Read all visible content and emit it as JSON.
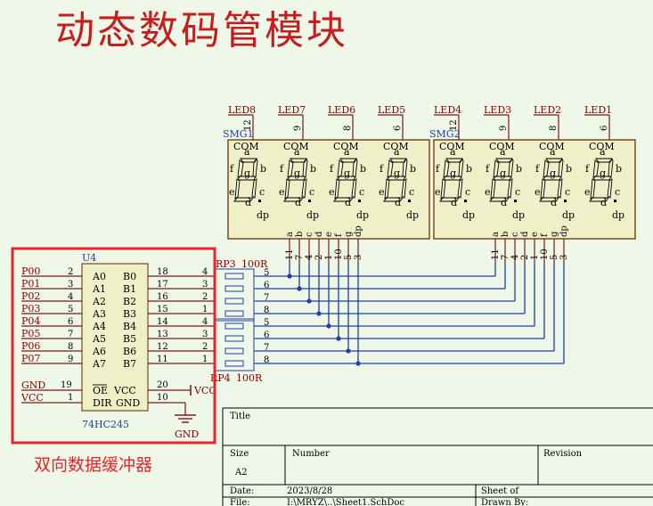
{
  "title": "动态数码管模块",
  "caption": "双向数据缓冲器",
  "smg1": {
    "ref": "SMG1",
    "digits": [
      {
        "led": "LED8",
        "pin": "12"
      },
      {
        "led": "LED7",
        "pin": "9"
      },
      {
        "led": "LED6",
        "pin": "8"
      },
      {
        "led": "LED5",
        "pin": "6"
      }
    ]
  },
  "smg2": {
    "ref": "SMG2",
    "digits": [
      {
        "led": "LED4",
        "pin": "12"
      },
      {
        "led": "LED3",
        "pin": "9"
      },
      {
        "led": "LED2",
        "pin": "8"
      },
      {
        "led": "LED1",
        "pin": "6"
      }
    ]
  },
  "digit_labels": {
    "com": "COM",
    "a": "a",
    "b": "b",
    "c": "c",
    "d": "d",
    "e": "e",
    "f": "f",
    "g": "g",
    "dp": "dp"
  },
  "seg_pins": {
    "names": [
      "a",
      "b",
      "c",
      "d",
      "e",
      "f",
      "g",
      "dp"
    ],
    "numbers": [
      "11",
      "7",
      "4",
      "2",
      "1",
      "10",
      "5",
      "3"
    ]
  },
  "u4": {
    "ref": "U4",
    "part": "74HC245",
    "left": [
      {
        "net": "P00",
        "pin": "2",
        "name": "A0"
      },
      {
        "net": "P01",
        "pin": "3",
        "name": "A1"
      },
      {
        "net": "P02",
        "pin": "4",
        "name": "A2"
      },
      {
        "net": "P03",
        "pin": "5",
        "name": "A3"
      },
      {
        "net": "P04",
        "pin": "6",
        "name": "A4"
      },
      {
        "net": "P05",
        "pin": "7",
        "name": "A5"
      },
      {
        "net": "P06",
        "pin": "8",
        "name": "A6"
      },
      {
        "net": "P07",
        "pin": "9",
        "name": "A7"
      }
    ],
    "right": [
      {
        "pin": "18",
        "name": "B0"
      },
      {
        "pin": "17",
        "name": "B1"
      },
      {
        "pin": "16",
        "name": "B2"
      },
      {
        "pin": "15",
        "name": "B3"
      },
      {
        "pin": "14",
        "name": "B4"
      },
      {
        "pin": "13",
        "name": "B5"
      },
      {
        "pin": "12",
        "name": "B6"
      },
      {
        "pin": "11",
        "name": "B7"
      }
    ],
    "gnd_net": "GND",
    "gnd_pin": "19",
    "oe": "OE",
    "vcc_net": "VCC",
    "vcc_pin": "1",
    "dir": "DIR",
    "vcc_name": "VCC",
    "vcc_name_pin": "20",
    "gnd_name": "GND",
    "gnd_name_pin": "10",
    "vcc_power": "VCC",
    "gnd_power": "GND"
  },
  "rp3": {
    "ref": "RP3",
    "value": "100R",
    "left": [
      "4",
      "3",
      "2",
      "1"
    ],
    "right": [
      "5",
      "6",
      "7",
      "8"
    ]
  },
  "rp4": {
    "ref": "RP4",
    "value": "100R",
    "left": [
      "4",
      "3",
      "2",
      "1"
    ],
    "right": [
      "5",
      "6",
      "7",
      "8"
    ]
  },
  "title_block": {
    "title_label": "Title",
    "size_label": "Size",
    "size": "A2",
    "number_label": "Number",
    "revision_label": "Revision",
    "date_label": "Date:",
    "date": "2023/8/28",
    "sheet_label": "Sheet    of",
    "file_label": "File:",
    "file": "I:\\MRYZ\\..\\Sheet1.SchDoc",
    "drawn_label": "Drawn By:"
  },
  "colors": {
    "background": "#EFF7E8",
    "wire": "#1F3FA8",
    "highlight_box": "#E8232A",
    "title_text": "#C41E1E",
    "part_body": "#EFF0C8"
  }
}
